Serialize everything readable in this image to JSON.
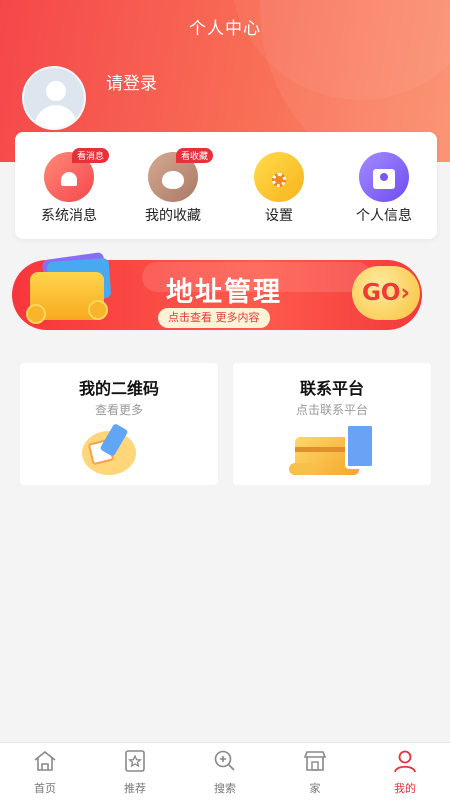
{
  "header": {
    "title": "个人中心"
  },
  "user": {
    "login_text": "请登录"
  },
  "quick_actions": [
    {
      "label": "系统消息",
      "badge": "看消息",
      "icon": "bell-icon"
    },
    {
      "label": "我的收藏",
      "badge": "看收藏",
      "icon": "money-bag-icon"
    },
    {
      "label": "设置",
      "badge": "",
      "icon": "gear-icon"
    },
    {
      "label": "个人信息",
      "badge": "",
      "icon": "user-card-icon"
    }
  ],
  "banner": {
    "title": "地址管理",
    "subtitle": "点击查看  更多内容",
    "go": "GO›"
  },
  "cards": [
    {
      "title": "我的二维码",
      "subtitle": "查看更多"
    },
    {
      "title": "联系平台",
      "subtitle": "点击联系平台"
    }
  ],
  "tabbar": [
    {
      "label": "首页",
      "icon": "home-icon",
      "active": false
    },
    {
      "label": "推荐",
      "icon": "star-icon",
      "active": false
    },
    {
      "label": "搜索",
      "icon": "search-icon",
      "active": false
    },
    {
      "label": "家",
      "icon": "store-icon",
      "active": false
    },
    {
      "label": "我的",
      "icon": "person-icon",
      "active": true
    }
  ],
  "colors": {
    "accent": "#e8303a",
    "header_start": "#f5474a",
    "header_end": "#fb8f6d"
  }
}
